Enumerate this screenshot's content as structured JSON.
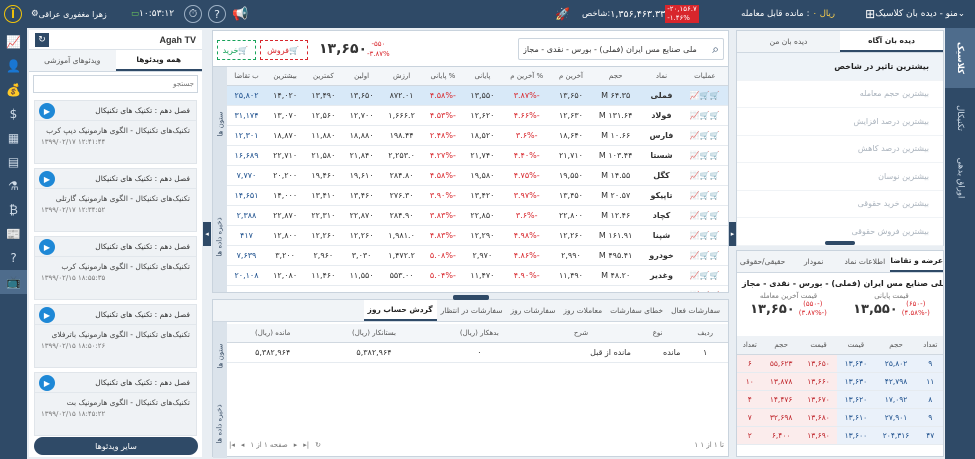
{
  "topbar": {
    "menu_label": "منو - دیده بان کلاسیک",
    "remaining_label": "مانده قابل معامله",
    "remaining_value": "۰ ریال",
    "index_label": "شاخص:",
    "index_value": "۱,۳۵۶,۴۶۳.۳۳",
    "index_change": "-۲۰,۱۵۶.۷",
    "index_pct": "-۱.۴۶%",
    "clock": "۱۰:۵۳:۱۲",
    "username": "زهرا مغفوری عراقی",
    "logo": "آگاه"
  },
  "left_rail_icons": [
    "chart-icon",
    "person-icon",
    "wallet-icon",
    "money-bag-icon",
    "grid-icon",
    "bars-icon",
    "flask-icon",
    "bitcoin-icon",
    "news-icon",
    "quiz-icon",
    "tv-icon"
  ],
  "right_rail": {
    "tabs": [
      "کلاسیک",
      "تکنیکال",
      "اوراق بدهی"
    ]
  },
  "watchlist": {
    "tabs": [
      "دیده بان من",
      "دیده بان آگاه"
    ],
    "items": [
      "بیشترین تاثیر در شاخص",
      "بیشترین حجم معامله",
      "بیشترین درصد افزایش",
      "بیشترین درصد کاهش",
      "بیشترین نوسان",
      "بیشترین خرید حقوقی",
      "بیشترین فروش حقوقی"
    ]
  },
  "symbol_bar": {
    "name": "ملی صنایع مس ایران (فملی) - بورس - نقدی - مجاز",
    "price": "۱۳,۶۵۰",
    "change": "-۵۵۰",
    "change_pct": "-۳.۸۷%",
    "sell_label": "فروش",
    "buy_label": "خرید"
  },
  "market_table": {
    "headers": [
      "عملیات",
      "نماد",
      "حجم",
      "آخرین م",
      "% آخرین م",
      "پایانی",
      "% پایانی",
      "ارزش",
      "اولین",
      "کمترین",
      "بیشترین",
      "ب تقاضا"
    ],
    "rows": [
      {
        "sym": "فملی",
        "vol": "۶۴.۳۵ M",
        "last": "۱۳,۶۵۰",
        "lastp": "-۳.۸۷%",
        "close": "۱۳,۵۵۰",
        "closep": "-۴.۵۸%",
        "val": "۸۷۲.۰۱",
        "first": "۱۳,۶۵۰",
        "low": "۱۳,۴۹۰",
        "high": "۱۴,۰۲۰",
        "bid": "۲۵,۸۰۲"
      },
      {
        "sym": "فولاد",
        "vol": "۱۳۱.۶۴ M",
        "last": "۱۲,۶۳۰",
        "lastp": "-۴.۶۶%",
        "close": "۱۲,۶۲۰",
        "closep": "-۴.۵۳%",
        "val": "۱,۶۶۶.۲",
        "first": "۱۲,۷۰۰",
        "low": "۱۲,۵۶۰",
        "high": "۱۳,۰۷۰",
        "bid": "۳۱,۱۷۴"
      },
      {
        "sym": "فارس",
        "vol": "۱۰.۶۶ M",
        "last": "۱۸,۶۴۰",
        "lastp": "-۳.۶%",
        "close": "۱۸,۵۲۰",
        "closep": "-۲.۴۸%",
        "val": "۱۹۸.۴۴",
        "first": "۱۸,۸۸۰",
        "low": "۱۱,۸۸۰",
        "high": "۱۸,۸۷۰",
        "bid": "۱۲,۳۰۱"
      },
      {
        "sym": "شستا",
        "vol": "۱۰۳.۴۴ M",
        "last": "۲۱,۷۱۰",
        "lastp": "-۴.۴۰%",
        "close": "۲۱,۷۴۰",
        "closep": "-۴.۲۷%",
        "val": "۲,۲۵۳.۰",
        "first": "۲۱,۸۴۰",
        "low": "۲۱,۵۸۰",
        "high": "۲۲,۷۱۰",
        "bid": "۱۶,۶۸۹"
      },
      {
        "sym": "کگل",
        "vol": "۱۴.۵۵ M",
        "last": "۱۹,۵۵۰",
        "lastp": "-۴.۷۵%",
        "close": "۱۹,۵۸۰",
        "closep": "-۴.۵۸%",
        "val": "۲۸۴.۸۰",
        "first": "۱۹,۶۱۰",
        "low": "۱۹,۴۶۰",
        "high": "۲۰,۲۰۰",
        "bid": "۷,۷۷۰"
      },
      {
        "sym": "تاپیکو",
        "vol": "۲۰.۵۷ M",
        "last": "۱۳,۴۵۰",
        "lastp": "-۳.۹۷%",
        "close": "۱۳,۴۲۰",
        "closep": "-۳.۹۰%",
        "val": "۲۷۶.۳۰",
        "first": "۱۳,۴۶۰",
        "low": "۱۳,۴۱۰",
        "high": "۱۴,۰۰۰",
        "bid": "۱۴,۶۵۱"
      },
      {
        "sym": "کچاد",
        "vol": "۱۲.۴۶ M",
        "last": "۲۲,۸۰۰",
        "lastp": "-۳.۶%",
        "close": "۲۲,۸۵۰",
        "closep": "-۳.۸۳%",
        "val": "۲۸۴.۹۰",
        "first": "۲۲,۸۷۰",
        "low": "۲۲,۳۱۰",
        "high": "۲۲,۸۷۰",
        "bid": "۲,۳۸۸"
      },
      {
        "sym": "شپنا",
        "vol": "۱۶۱.۹۱ M",
        "last": "۱۲,۲۶۰",
        "lastp": "-۴.۹۸%",
        "close": "۱۲,۲۹۰",
        "closep": "-۴.۸۳%",
        "val": "۱,۹۸۱.۰",
        "first": "۱۲,۲۶۰",
        "low": "۱۲,۲۶۰",
        "high": "۱۲,۸۰۰",
        "bid": "۴۱۷"
      },
      {
        "sym": "خودرو",
        "vol": "۴۹۵.۴۱ M",
        "last": "۲,۹۹۰",
        "lastp": "-۴.۸۶%",
        "close": "۲,۹۷۰",
        "closep": "-۵.۰۸%",
        "val": "۱,۴۷۲.۲",
        "first": "۳,۰۳۰",
        "low": "۲,۹۶۰",
        "high": "۳,۲۰۰",
        "bid": "۷,۶۳۹"
      },
      {
        "sym": "وغدیر",
        "vol": "۴۸.۲۰ M",
        "last": "۱۱,۴۹۰",
        "lastp": "-۴.۹۰%",
        "close": "۱۱,۴۷۰",
        "closep": "-۵.۰۴%",
        "val": "۵۵۳.۰۰",
        "first": "۱۱,۵۵۰",
        "low": "۱۱,۴۶۰",
        "high": "۱۲,۰۸۰",
        "bid": "۲۰,۱۰۸"
      },
      {
        "sym": "شتران",
        "vol": "۱۱۱.۶۴ M",
        "last": "۲,۶۲۰",
        "lastp": "-۴.۸۸%",
        "close": "۲,۶۴۰",
        "closep": "-۴.۶۵%",
        "val": "۲۹۵.۰۰",
        "first": "۲,۶۶۰",
        "low": "۲,۶۲۰",
        "high": "۲,۷۹۰",
        "bid": "۲۳,۸۰۶"
      }
    ]
  },
  "orders_panel": {
    "tabs": [
      "سفارشات فعال",
      "خطای سفارشات",
      "معاملات روز",
      "سفارشات روز",
      "سفارشات در انتظار",
      "گردش حساب روز"
    ],
    "headers": [
      "ردیف",
      "نوع",
      "شرح",
      "بدهکار (ریال)",
      "بستانکار (ریال)",
      "مانده (ریال)"
    ],
    "row": {
      "idx": "۱",
      "type": "مانده",
      "desc": "مانده از قبل",
      "debit": "۰",
      "credit": "۵,۳۸۲,۹۶۴",
      "balance": "۵,۳۸۲,۹۶۴"
    },
    "pager": "صفحه ۱ از ۱",
    "range": "۱ تا ۱ از ۱",
    "side_tabs": [
      "ستون ها",
      "ذخیره داده ها"
    ]
  },
  "table_side_tabs": [
    "ستون ها",
    "ذخیره داده ها"
  ],
  "detail_panel": {
    "tabs": [
      "عرضه و تقاضا",
      "اطلاعات نماد",
      "نمودار",
      "حقیقی/حقوقی"
    ],
    "title": "ملی صنایع مس ایران (فملی) - بورس - نقدی - مجاز",
    "close_label": "قیمت پایانی",
    "close_value": "۱۳,۵۵۰",
    "close_change": "(۶۵۰-)",
    "close_pct": "(۴.۵۸%-)",
    "last_label": "قیمت آخرین معامله",
    "last_value": "۱۳,۶۵۰",
    "last_change": "(۵۵۰-)",
    "last_pct": "(۳.۸۷%-)",
    "ob_headers": [
      "تعداد",
      "حجم",
      "قیمت",
      "قیمت",
      "حجم",
      "تعداد"
    ],
    "ob_rows": [
      [
        "۹",
        "۲۵,۸۰۲",
        "۱۳,۶۴۰",
        "۱۳,۶۵۰",
        "۵۵,۶۲۳",
        "۶"
      ],
      [
        "۱۱",
        "۴۲,۷۹۸",
        "۱۳,۶۳۰",
        "۱۳,۶۶۰",
        "۱۳,۸۷۸",
        "۱۰"
      ],
      [
        "۸",
        "۱۷,۰۹۲",
        "۱۳,۶۲۰",
        "۱۳,۶۷۰",
        "۱۴,۴۷۶",
        "۴"
      ],
      [
        "۹",
        "۲۷,۹۰۱",
        "۱۳,۶۱۰",
        "۱۳,۶۸۰",
        "۳۲,۶۹۸",
        "۷"
      ],
      [
        "۴۷",
        "۲۰۴,۳۱۶",
        "۱۳,۶۰۰",
        "۱۳,۶۹۰",
        "۶,۴۰۰",
        "۲"
      ]
    ]
  },
  "aghah_tv": {
    "title": "Agah TV",
    "tabs": [
      "همه ویدئوها",
      "ویدئوهای آموزشی"
    ],
    "search_placeholder": "جستجو",
    "videos": [
      {
        "cat": "فصل دهم : تکنیک های تکنیکال",
        "title": "تکنیک‌های تکنیکال - الگوی هارمونیک دیپ کرب",
        "date": "۱۳۹۹/۰۲/۱۷ ۱۲:۴۱:۴۴"
      },
      {
        "cat": "فصل دهم : تکنیک های تکنیکال",
        "title": "تکنیک‌های تکنیکال - الگوی هارمونیک گارتلی",
        "date": "۱۳۹۹/۰۲/۱۷ ۱۲:۳۴:۵۲"
      },
      {
        "cat": "فصل دهم : تکنیک های تکنیکال",
        "title": "تکنیک‌های تکنیکال - الگوی هارمونیک کرب",
        "date": "۱۳۹۹/۰۲/۱۵ ۱۸:۵۵:۳۵"
      },
      {
        "cat": "فصل دهم : تکنیک های تکنیکال",
        "title": "تکنیک‌های تکنیکال - الگوی هارمونیک باترفلای",
        "date": "۱۳۹۹/۰۲/۱۵ ۱۸:۵۰:۲۶"
      },
      {
        "cat": "فصل دهم : تکنیک های تکنیکال",
        "title": "تکنیک‌های تکنیکال - الگوی هارمونیک بت",
        "date": "۱۳۹۹/۰۲/۱۵ ۱۸:۴۵:۲۲"
      }
    ],
    "more_label": "سایر ویدئوها"
  }
}
